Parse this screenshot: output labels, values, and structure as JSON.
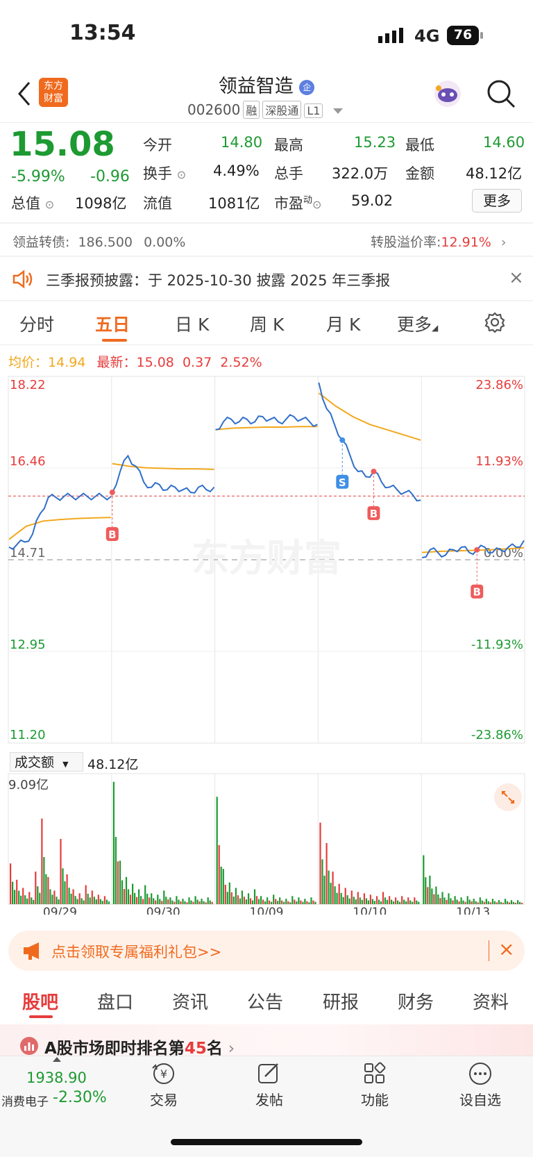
{
  "status_bar": {
    "time": "13:54",
    "network": "4G",
    "battery": "76"
  },
  "header": {
    "title": "领益智造",
    "title_badge": "企",
    "code": "002600",
    "tags": [
      "融",
      "深股通",
      "L1"
    ]
  },
  "quote": {
    "price": "15.08",
    "change_pct": "-5.99%",
    "change": "-0.96",
    "open_label": "今开",
    "open": "14.80",
    "high_label": "最高",
    "high": "15.23",
    "low_label": "最低",
    "low": "14.60",
    "turnover_label": "换手",
    "turnover": "4.49%",
    "volume_label": "总手",
    "volume": "322.0万",
    "amount_label": "金额",
    "amount": "48.12亿",
    "mktcap_label": "总值",
    "mktcap": "1098亿",
    "float_label": "流值",
    "float": "1081亿",
    "pe_label": "市盈",
    "pe_sup": "动",
    "pe": "59.02",
    "more_button": "更多"
  },
  "bond": {
    "label": "领益转债:",
    "price": "186.500",
    "pct": "0.00%",
    "premium_label": "转股溢价率:",
    "premium": "12.91%"
  },
  "notice": {
    "text": "三季报预披露：于 2025-10-30 披露 2025 年三季报"
  },
  "chart_tabs": [
    "分时",
    "五日",
    "日 K",
    "周 K",
    "月 K",
    "更多"
  ],
  "chart_tab_active": 1,
  "chart_info": {
    "avg_label": "均价：",
    "avg": "14.94",
    "latest_label": "最新：",
    "latest": "15.08",
    "latest_change": "0.37",
    "latest_pct": "2.52%"
  },
  "watermark": "东方财富",
  "chart_data": {
    "type": "line",
    "title": "",
    "y_left_ticks": [
      "18.22",
      "16.46",
      "14.71",
      "12.95",
      "11.20"
    ],
    "y_right_ticks": [
      "23.86%",
      "11.93%",
      "0.00%",
      "-11.93%",
      "-23.86%"
    ],
    "ylim": [
      11.2,
      18.22
    ],
    "prev_close": 14.71,
    "current_line": 15.93,
    "days": [
      "09/29",
      "09/30",
      "10/09",
      "10/10",
      "10/13"
    ],
    "series": [
      {
        "values": [
          [
            14.95,
            15.0,
            15.05,
            15.2,
            15.6,
            15.9,
            15.9,
            15.92,
            15.92,
            15.92,
            15.92,
            15.92,
            15.92,
            15.92
          ],
          [
            16.0,
            16.4,
            16.7,
            16.5,
            16.2,
            16.1,
            16.15,
            16.05,
            16.1,
            16.05,
            16.0,
            16.1,
            16.05,
            16.1
          ],
          [
            17.2,
            17.35,
            17.4,
            17.35,
            17.4,
            17.35,
            17.45,
            17.4,
            17.35,
            17.4,
            17.45,
            17.4,
            17.35,
            17.3
          ],
          [
            18.1,
            17.6,
            17.3,
            17.0,
            16.7,
            16.4,
            16.3,
            16.4,
            16.2,
            16.1,
            16.05,
            16.0,
            15.95,
            15.85
          ],
          [
            14.75,
            14.9,
            14.85,
            14.8,
            14.9,
            14.95,
            14.85,
            14.9,
            14.95,
            14.85,
            14.9,
            14.95,
            14.95,
            15.08
          ]
        ]
      },
      {
        "values": [
          [
            15.1,
            15.35,
            15.45,
            15.48,
            15.5,
            15.51,
            15.52
          ],
          [
            16.55,
            16.5,
            16.47,
            16.46,
            16.45,
            16.45,
            16.44
          ],
          [
            17.2,
            17.23,
            17.24,
            17.25,
            17.25,
            17.26,
            17.26
          ],
          [
            17.9,
            17.65,
            17.45,
            17.3,
            17.2,
            17.1,
            17.0
          ],
          [
            14.85,
            14.87,
            14.88,
            14.89,
            14.9,
            14.92,
            14.94
          ]
        ]
      }
    ],
    "markers": [
      {
        "day": 1,
        "pos": 0.0,
        "label": "B"
      },
      {
        "day": 3,
        "pos": 0.25,
        "label": "S"
      },
      {
        "day": 3,
        "pos": 0.5,
        "label": "B"
      },
      {
        "day": 4,
        "pos": 0.55,
        "label": "B"
      }
    ],
    "volume_label": "成交额",
    "volume_total": "48.12亿",
    "volume_max": "9.09亿",
    "volume_spikes": [
      [
        3.0,
        1.8,
        1.2,
        0.9,
        2.4,
        6.3,
        2.0,
        1.0,
        4.8,
        2.2,
        1.1,
        0.8,
        1.4,
        1.0,
        0.7,
        0.6
      ],
      [
        9.0,
        3.2,
        2.0,
        1.5,
        1.1,
        1.4,
        0.8,
        0.7,
        1.0,
        0.5,
        0.6,
        0.4,
        0.5,
        0.6,
        0.4,
        0.5
      ],
      [
        7.9,
        2.6,
        1.6,
        1.2,
        1.0,
        0.8,
        1.1,
        0.6,
        0.5,
        0.7,
        0.5,
        0.4,
        0.6,
        0.5,
        0.4,
        0.5
      ],
      [
        6.0,
        4.5,
        2.4,
        1.5,
        1.2,
        1.0,
        0.9,
        0.8,
        0.7,
        0.6,
        0.9,
        0.6,
        0.5,
        0.6,
        0.5,
        0.5
      ],
      [
        3.6,
        2.1,
        1.3,
        0.9,
        0.8,
        0.6,
        0.5,
        0.6,
        0.4,
        0.5,
        0.4,
        0.4,
        0.3,
        0.4,
        0.3,
        0.3
      ]
    ]
  },
  "promo": {
    "text": "点击领取专属福利礼包>>"
  },
  "bottom_tabs": [
    "股吧",
    "盘口",
    "资讯",
    "公告",
    "研报",
    "财务",
    "资料"
  ],
  "bottom_tab_active": 0,
  "ranking": {
    "prefix": "A股市场即时排名第",
    "rank": "45",
    "suffix": "名"
  },
  "sector": {
    "value": "1938.90",
    "name": "消费电子",
    "pct": "-2.30%"
  },
  "nav": [
    "交易",
    "发帖",
    "功能",
    "设自选"
  ],
  "colors": {
    "up": "#e63c3c",
    "down": "#1d9a32",
    "price_line": "#2f6fc9",
    "avg_line": "#f2a81d",
    "accent": "#f06a1e"
  }
}
